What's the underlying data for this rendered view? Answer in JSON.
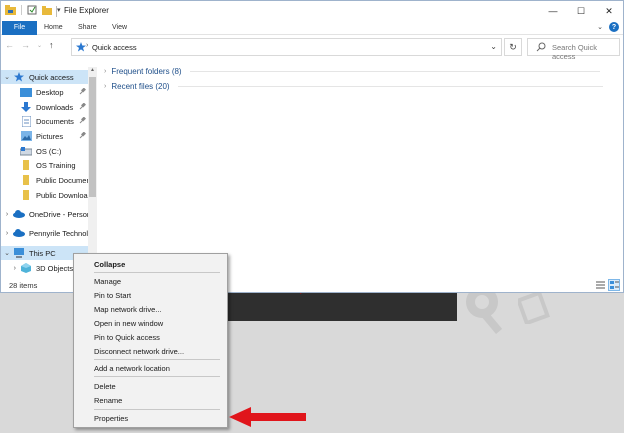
{
  "window": {
    "title": "File Explorer",
    "controls": {
      "minimize": "—",
      "maximize": "☐",
      "close": "✕"
    }
  },
  "ribbon": {
    "tabs": [
      "File",
      "Home",
      "Share",
      "View"
    ],
    "help": "?"
  },
  "address": {
    "path": "Quick access",
    "search_placeholder": "Search Quick access"
  },
  "nav": {
    "items": [
      {
        "label": "Quick access",
        "icon": "star-icon",
        "selected": true
      },
      {
        "label": "Desktop",
        "icon": "desktop-folder-icon",
        "pinned": true
      },
      {
        "label": "Downloads",
        "icon": "download-folder-icon",
        "pinned": true
      },
      {
        "label": "Documents",
        "icon": "documents-folder-icon",
        "pinned": true
      },
      {
        "label": "Pictures",
        "icon": "pictures-folder-icon",
        "pinned": true
      },
      {
        "label": "OS (C:)",
        "icon": "drive-icon"
      },
      {
        "label": "OS Training",
        "icon": "folder-icon"
      },
      {
        "label": "Public Documen",
        "icon": "folder-icon"
      },
      {
        "label": "Public Downloa",
        "icon": "folder-icon"
      },
      {
        "label": "OneDrive - Person",
        "icon": "cloud-icon"
      },
      {
        "label": "Pennyrile Technol",
        "icon": "cloud-icon"
      },
      {
        "label": "This PC",
        "icon": "computer-icon",
        "selected": true
      },
      {
        "label": "3D Objects",
        "icon": "3d-objects-icon"
      }
    ]
  },
  "main": {
    "groups": [
      {
        "label": "Frequent folders (8)"
      },
      {
        "label": "Recent files (20)"
      }
    ]
  },
  "status": {
    "items_count": "28 items"
  },
  "context_menu": {
    "items": [
      "Collapse",
      "Manage",
      "Pin to Start",
      "Map network drive...",
      "Open in new window",
      "Pin to Quick access",
      "Disconnect network drive...",
      "Add a network location",
      "Delete",
      "Rename",
      "Properties"
    ]
  },
  "colors": {
    "accent": "#1a6fc2",
    "selection": "#cce4f7",
    "arrow": "#e0151b"
  }
}
